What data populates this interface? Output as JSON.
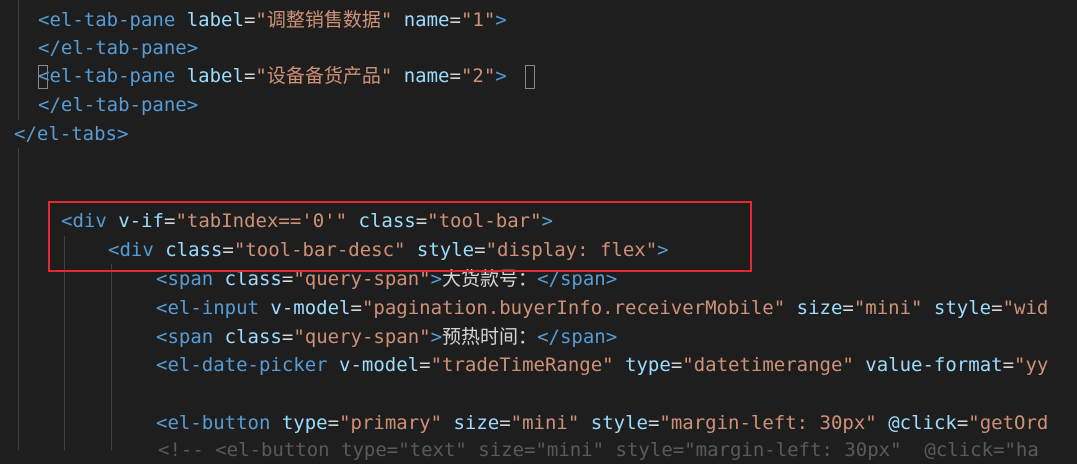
{
  "lines": [
    {
      "indent": "  ",
      "tokens": [
        [
          "<",
          "tag"
        ],
        [
          "el-tab-pane",
          "tag"
        ],
        [
          " label",
          "attr"
        ],
        [
          "=",
          "txt"
        ],
        [
          "\"调整销售数据\"",
          "str"
        ],
        [
          " name",
          "attr"
        ],
        [
          "=",
          "txt"
        ],
        [
          "\"1\"",
          "str"
        ],
        [
          ">",
          "tag"
        ]
      ]
    },
    {
      "indent": "  ",
      "tokens": [
        [
          "</",
          "tag"
        ],
        [
          "el-tab-pane",
          "tag"
        ],
        [
          ">",
          "tag"
        ]
      ]
    },
    {
      "indent": "  ",
      "tokens": [
        [
          "<",
          "tag"
        ],
        [
          "el-tab-pane",
          "tag"
        ],
        [
          " label",
          "attr"
        ],
        [
          "=",
          "txt"
        ],
        [
          "\"设备备货产品\"",
          "str"
        ],
        [
          " name",
          "attr"
        ],
        [
          "=",
          "txt"
        ],
        [
          "\"2\"",
          "str"
        ],
        [
          ">",
          "tag"
        ]
      ]
    },
    {
      "indent": "  ",
      "tokens": [
        [
          "</",
          "tag"
        ],
        [
          "el-tab-pane",
          "tag"
        ],
        [
          ">",
          "tag"
        ]
      ]
    },
    {
      "indent": "",
      "tokens": [
        [
          "</",
          "tag"
        ],
        [
          "el-tabs",
          "tag"
        ],
        [
          ">",
          "tag"
        ]
      ]
    },
    {
      "indent": "",
      "tokens": []
    },
    {
      "indent": "",
      "tokens": []
    },
    {
      "indent": "    ",
      "tokens": [
        [
          "<",
          "tag"
        ],
        [
          "div",
          "tag"
        ],
        [
          " v-if",
          "attr"
        ],
        [
          "=",
          "txt"
        ],
        [
          "\"tabIndex==",
          "str"
        ],
        [
          "'0'",
          "str"
        ],
        [
          "\"",
          "str"
        ],
        [
          " class",
          "attr"
        ],
        [
          "=",
          "txt"
        ],
        [
          "\"tool-bar\"",
          "str"
        ],
        [
          ">",
          "tag"
        ]
      ]
    },
    {
      "indent": "        ",
      "tokens": [
        [
          "<",
          "tag"
        ],
        [
          "div",
          "tag"
        ],
        [
          " class",
          "attr"
        ],
        [
          "=",
          "txt"
        ],
        [
          "\"tool-bar-desc\"",
          "str"
        ],
        [
          " style",
          "attr"
        ],
        [
          "=",
          "txt"
        ],
        [
          "\"display: flex\"",
          "str"
        ],
        [
          ">",
          "tag"
        ]
      ]
    },
    {
      "indent": "            ",
      "tokens": [
        [
          "<",
          "tag"
        ],
        [
          "span",
          "tag"
        ],
        [
          " class",
          "attr"
        ],
        [
          "=",
          "txt"
        ],
        [
          "\"query-span\"",
          "str"
        ],
        [
          ">",
          "tag"
        ],
        [
          "大货款号：",
          "txt"
        ],
        [
          "</",
          "tag"
        ],
        [
          "span",
          "tag"
        ],
        [
          ">",
          "tag"
        ]
      ]
    },
    {
      "indent": "            ",
      "tokens": [
        [
          "<",
          "tag"
        ],
        [
          "el-input",
          "tag"
        ],
        [
          " v-model",
          "attr"
        ],
        [
          "=",
          "txt"
        ],
        [
          "\"pagination.buyerInfo.receiverMobile\"",
          "str"
        ],
        [
          " size",
          "attr"
        ],
        [
          "=",
          "txt"
        ],
        [
          "\"mini\"",
          "str"
        ],
        [
          " style",
          "attr"
        ],
        [
          "=",
          "txt"
        ],
        [
          "\"wid",
          "str"
        ]
      ]
    },
    {
      "indent": "            ",
      "tokens": [
        [
          "<",
          "tag"
        ],
        [
          "span",
          "tag"
        ],
        [
          " class",
          "attr"
        ],
        [
          "=",
          "txt"
        ],
        [
          "\"query-span\"",
          "str"
        ],
        [
          ">",
          "tag"
        ],
        [
          "预热时间：",
          "txt"
        ],
        [
          "</",
          "tag"
        ],
        [
          "span",
          "tag"
        ],
        [
          ">",
          "tag"
        ]
      ]
    },
    {
      "indent": "            ",
      "tokens": [
        [
          "<",
          "tag"
        ],
        [
          "el-date-picker",
          "tag"
        ],
        [
          " v-model",
          "attr"
        ],
        [
          "=",
          "txt"
        ],
        [
          "\"tradeTimeRange\"",
          "str"
        ],
        [
          " type",
          "attr"
        ],
        [
          "=",
          "txt"
        ],
        [
          "\"datetimerange\"",
          "str"
        ],
        [
          " value-format",
          "attr"
        ],
        [
          "=",
          "txt"
        ],
        [
          "\"yy",
          "str"
        ]
      ]
    },
    {
      "indent": "",
      "tokens": []
    },
    {
      "indent": "            ",
      "tokens": [
        [
          "<",
          "tag"
        ],
        [
          "el-button",
          "tag"
        ],
        [
          " type",
          "attr"
        ],
        [
          "=",
          "txt"
        ],
        [
          "\"primary\"",
          "str"
        ],
        [
          " size",
          "attr"
        ],
        [
          "=",
          "txt"
        ],
        [
          "\"mini\"",
          "str"
        ],
        [
          " style",
          "attr"
        ],
        [
          "=",
          "txt"
        ],
        [
          "\"margin-left: 30px\"",
          "str"
        ],
        [
          " @click",
          "attr"
        ],
        [
          "=",
          "txt"
        ],
        [
          "\"getOrd",
          "str"
        ]
      ]
    }
  ],
  "partial_line": "<!-- <el-button type=\"text\" size=\"mini\" style=\"margin-left: 30px\"  @click=\"ha"
}
